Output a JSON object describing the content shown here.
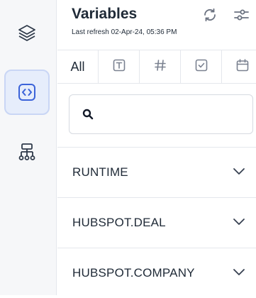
{
  "panel": {
    "title": "Variables",
    "subtitle": "Last refresh 02-Apr-24, 05:36 PM"
  },
  "rail": {
    "items": [
      {
        "icon": "layers-icon",
        "active": false
      },
      {
        "icon": "code-brackets-icon",
        "active": true
      },
      {
        "icon": "hierarchy-icon",
        "active": false
      }
    ]
  },
  "tabs": [
    {
      "label": "All",
      "icon": null
    },
    {
      "label": "",
      "icon": "text-type-icon"
    },
    {
      "label": "",
      "icon": "number-hash-icon"
    },
    {
      "label": "",
      "icon": "checkbox-icon"
    },
    {
      "label": "",
      "icon": "calendar-icon"
    }
  ],
  "search": {
    "value": "",
    "placeholder": ""
  },
  "sections": [
    {
      "label": "RUNTIME"
    },
    {
      "label": "HUBSPOT.DEAL"
    },
    {
      "label": "HUBSPOT.COMPANY"
    }
  ],
  "colors": {
    "accent": "#3b63d9",
    "active_bg": "#e6edfb",
    "border": "#e4e7ec"
  }
}
